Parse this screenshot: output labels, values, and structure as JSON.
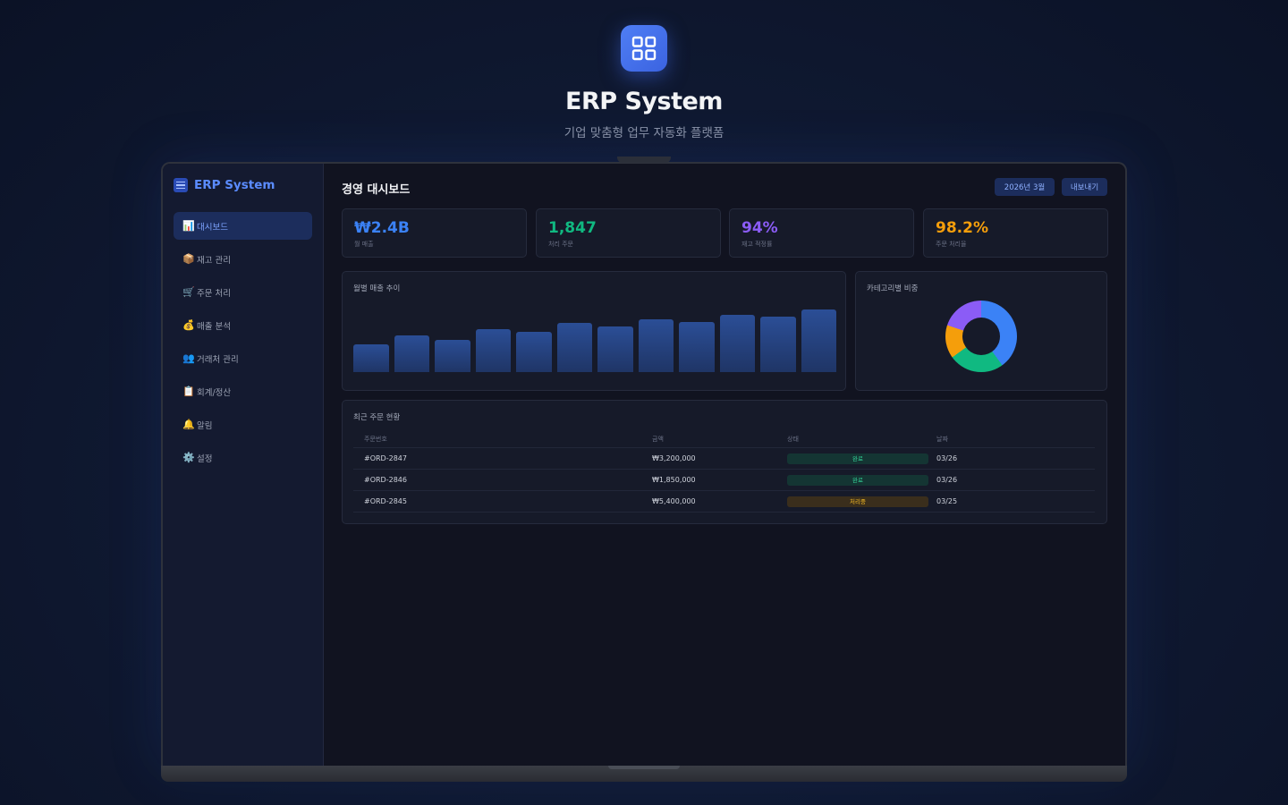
{
  "hero": {
    "icon": "grid-icon",
    "title": "ERP System",
    "subtitle": "기업 맞춤형 업무 자동화 플랫폼"
  },
  "app": {
    "brand": "ERP System",
    "brand_icon": "menu-lines-icon"
  },
  "sidebar": {
    "items": [
      {
        "icon": "📊",
        "label": "대시보드",
        "active": true
      },
      {
        "icon": "📦",
        "label": "재고 관리",
        "active": false
      },
      {
        "icon": "🛒",
        "label": "주문 처리",
        "active": false
      },
      {
        "icon": "💰",
        "label": "매출 분석",
        "active": false
      },
      {
        "icon": "👥",
        "label": "거래처 관리",
        "active": false
      },
      {
        "icon": "📋",
        "label": "회계/정산",
        "active": false
      },
      {
        "icon": "🔔",
        "label": "알림",
        "active": false
      },
      {
        "icon": "⚙️",
        "label": "설정",
        "active": false
      }
    ]
  },
  "header": {
    "title": "경영 대시보드",
    "period": "2026년 3월",
    "export": "내보내기"
  },
  "kpis": [
    {
      "value": "₩2.4B",
      "label": "월 매출",
      "color": "#3b82f6"
    },
    {
      "value": "1,847",
      "label": "처리 주문",
      "color": "#10b981"
    },
    {
      "value": "94%",
      "label": "재고 적정률",
      "color": "#8b5cf6"
    },
    {
      "value": "98.2%",
      "label": "주문 처리율",
      "color": "#f59e0b"
    }
  ],
  "monthly_chart": {
    "title": "월별 매출 추이"
  },
  "category_chart": {
    "title": "카테고리별 비중"
  },
  "chart_data": [
    {
      "type": "bar",
      "title": "월별 매출 추이",
      "values": [
        40,
        52,
        46,
        62,
        58,
        70,
        65,
        76,
        72,
        82,
        79,
        90
      ],
      "ylim": [
        0,
        100
      ],
      "grid": false,
      "color": "#2b4e96"
    },
    {
      "type": "pie",
      "title": "카테고리별 비중",
      "values": [
        40,
        25,
        15,
        20
      ],
      "colors": [
        "#3b82f6",
        "#10b981",
        "#f59e0b",
        "#8b5cf6"
      ]
    }
  ],
  "orders": {
    "title": "최근 주문 현황",
    "columns": [
      "주문번호",
      "금액",
      "상태",
      "날짜"
    ],
    "rows": [
      {
        "id": "#ORD-2847",
        "amount": "₩3,200,000",
        "status": "완료",
        "status_type": "done",
        "date": "03/26"
      },
      {
        "id": "#ORD-2846",
        "amount": "₩1,850,000",
        "status": "완료",
        "status_type": "done",
        "date": "03/26"
      },
      {
        "id": "#ORD-2845",
        "amount": "₩5,400,000",
        "status": "처리중",
        "status_type": "proc",
        "date": "03/25"
      }
    ]
  }
}
